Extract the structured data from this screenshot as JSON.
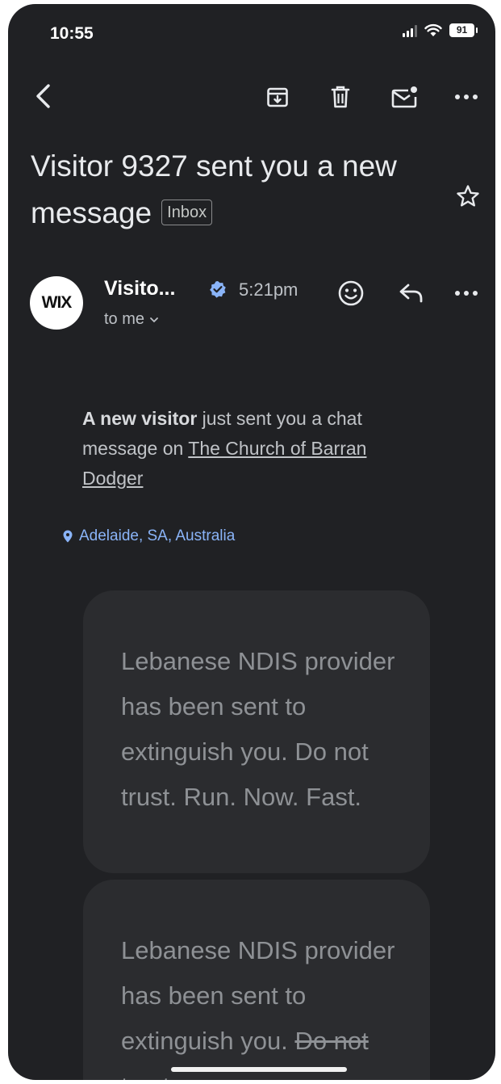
{
  "status_bar": {
    "time": "10:55",
    "battery": "91"
  },
  "toolbar": {
    "back_icon": "arrow-back-icon",
    "archive_icon": "archive-icon",
    "delete_icon": "trash-icon",
    "mark_unread_icon": "mark-unread-icon",
    "more_icon": "more-horizontal-icon"
  },
  "email": {
    "subject": "Visitor 9327 sent you a new message",
    "label": "Inbox",
    "sender": "Visito...",
    "time": "5:21pm",
    "to": "to me",
    "avatar_text": "WIX",
    "body": {
      "bold": "A new visitor",
      "text": " just sent you a chat message on ",
      "link": "The Church of Barran Dodger",
      "location": "Adelaide, SA, Australia"
    },
    "messages": [
      "Lebanese NDIS provider has been sent to extinguish you. Do not trust. Run. Now. Fast.",
      "Lebanese NDIS provider has been sent to extinguish you. Do not trust."
    ],
    "message_2_visible": "Lebanese NDIS provider has been sent to extinguish you.",
    "message_2_struck": "Do not trust."
  },
  "colors": {
    "background": "#202124",
    "card": "#2b2c2f",
    "accent_link": "#8ab4f8",
    "verified": "#8ab4f8"
  }
}
